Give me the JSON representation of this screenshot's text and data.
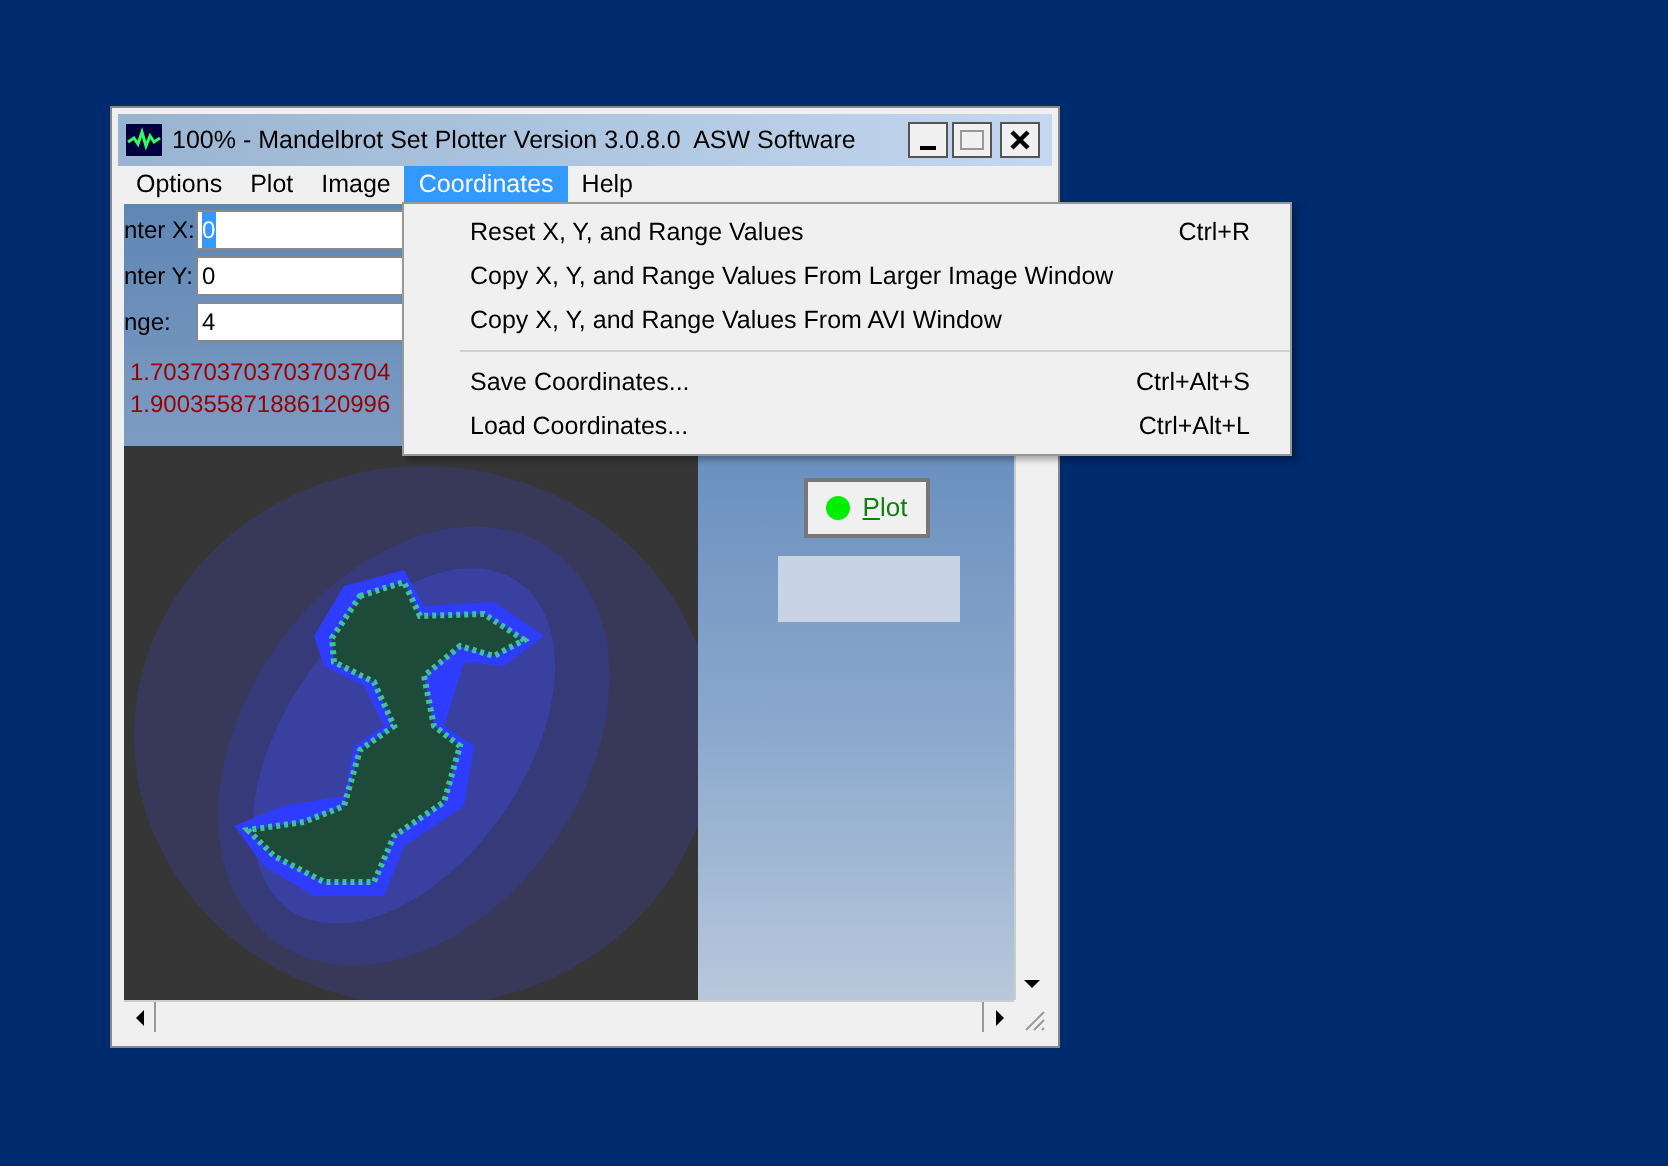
{
  "window": {
    "title": "100% - Mandelbrot Set Plotter Version 3.0.8.0  ASW Software"
  },
  "menu_bar": [
    {
      "label": "Options",
      "selected": false
    },
    {
      "label": "Plot",
      "selected": false
    },
    {
      "label": "Image",
      "selected": false
    },
    {
      "label": "Coordinates",
      "selected": true
    },
    {
      "label": "Help",
      "selected": false
    }
  ],
  "fields": [
    {
      "label": "nter X:",
      "value": "0",
      "selected": true
    },
    {
      "label": "nter Y:",
      "value": "0",
      "selected": false
    },
    {
      "label": "nge:",
      "value": "4",
      "selected": false
    }
  ],
  "readouts": [
    "1.703703703703703704",
    "1.900355871886120996"
  ],
  "dropdown": [
    {
      "kind": "item",
      "label": "Reset X, Y, and Range Values",
      "shortcut": "Ctrl+R"
    },
    {
      "kind": "item",
      "label": "Copy X, Y, and Range Values From Larger Image Window"
    },
    {
      "kind": "item",
      "label": "Copy X, Y, and Range Values From AVI Window"
    },
    {
      "kind": "separator"
    },
    {
      "kind": "item",
      "label": "Save Coordinates...",
      "shortcut": "Ctrl+Alt+S"
    },
    {
      "kind": "item",
      "label": "Load Coordinates...",
      "shortcut": "Ctrl+Alt+L"
    }
  ],
  "plot_button": {
    "label": "Plot"
  }
}
